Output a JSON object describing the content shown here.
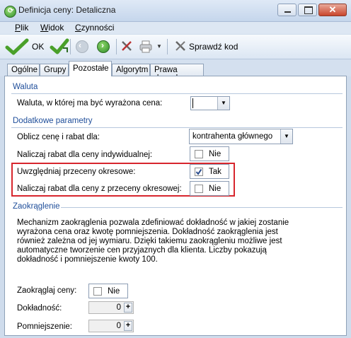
{
  "window": {
    "title": "Definicja ceny: Detaliczna"
  },
  "menu": [
    "Plik",
    "Widok",
    "Czynności"
  ],
  "toolbar": {
    "ok_label": "OK",
    "check_code_label": "Sprawdź kod"
  },
  "tabs": [
    "Ogólne",
    "Grupy",
    "Pozostałe",
    "Algorytm",
    "Prawa danych"
  ],
  "active_tab": "Pozostałe",
  "sections": {
    "currency": {
      "header": "Waluta",
      "label": "Waluta, w której ma być wyrażona cena:",
      "value": ""
    },
    "extra": {
      "header": "Dodatkowe parametry",
      "calc_label": "Oblicz cenę i rabat dla:",
      "calc_value": "kontrahenta głównego",
      "individual_label": "Naliczaj rabat dla ceny indywidualnej:",
      "individual_value": "Nie",
      "periodic_label": "Uwzględniaj przeceny okresowe:",
      "periodic_value": "Tak",
      "periodic_discount_label": "Naliczaj rabat dla ceny z przeceny okresowej:",
      "periodic_discount_value": "Nie"
    },
    "rounding": {
      "header": "Zaokrąglenie",
      "description_lines": [
        "Mechanizm zaokrąglenia pozwala zdefiniować dokładność w jakiej zostanie",
        "wyrażona cena oraz kwotę pomniejszenia. Dokładność zaokrąglenia jest",
        "również zależna od jej wymiaru. Dzięki takiemu zaokrągleniu możliwe jest",
        "automatyczne tworzenie cen przyjaznych dla klienta. Liczby pokazują",
        "dokładność i pomniejszenie kwoty 100."
      ],
      "round_label": "Zaokrąglaj ceny:",
      "round_value": "Nie",
      "precision_label": "Dokładność:",
      "precision_value": "0",
      "reduction_label": "Pomniejszenie:",
      "reduction_value": "0"
    }
  },
  "checkbox_states": {
    "individual": false,
    "periodic": true,
    "periodic_discount": false,
    "round": false
  },
  "colors": {
    "highlight": "#d7262d",
    "section_header": "#1f4e9a",
    "title_bar": "#c5d6ec"
  }
}
